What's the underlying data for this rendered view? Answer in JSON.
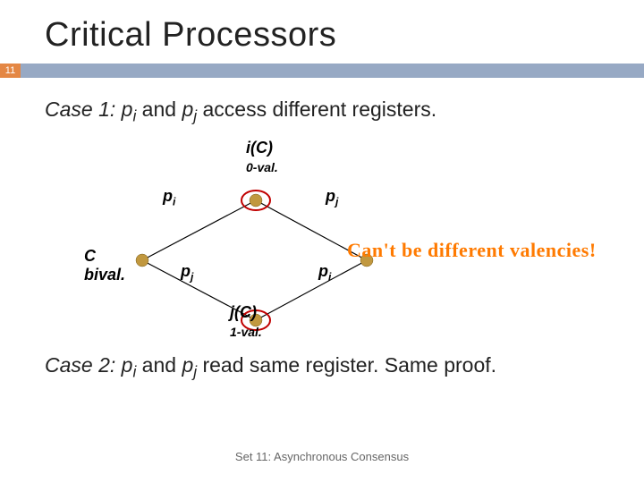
{
  "title": "Critical Processors",
  "page_number": "11",
  "case1": {
    "prefix": "Case 1: ",
    "p_i": "p",
    "p_i_sub": "i",
    "mid": " and ",
    "p_j": "p",
    "p_j_sub": "j",
    "tail": " access different registers."
  },
  "diagram": {
    "top_label_line1": "i(C)",
    "top_label_line2": "0-val.",
    "pi_label": "p",
    "pi_sub": "i",
    "pj_label": "p",
    "pj_sub": "j",
    "c_label_line1": "C",
    "c_label_line2": "bival.",
    "pj2_label": "p",
    "pj2_sub": "j",
    "pi2_label": "p",
    "pi2_sub": "i",
    "bot_label_line1": "j(C)",
    "bot_label_line2": "1-val.",
    "callout": "Can't be different valencies!"
  },
  "case2": {
    "prefix": "Case 2: ",
    "p_i": "p",
    "p_i_sub": "i",
    "mid": " and ",
    "p_j": "p",
    "p_j_sub": "j",
    "tail": " read same register.  Same proof."
  },
  "footer": "Set 11: Asynchronous Consensus"
}
